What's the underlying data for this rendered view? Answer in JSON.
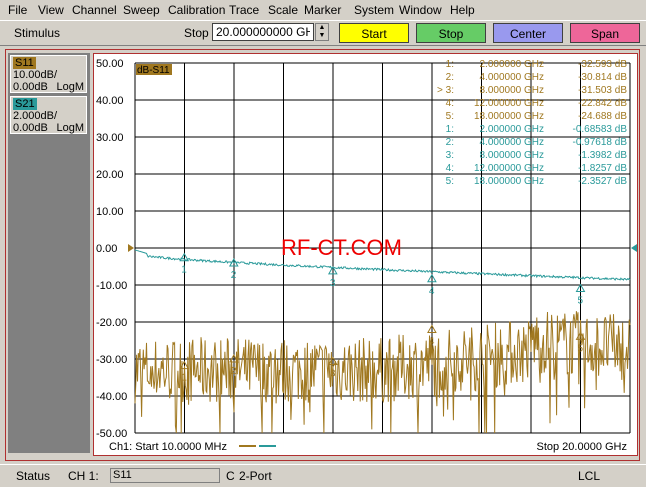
{
  "menu": [
    "File",
    "View",
    "Channel",
    "Sweep",
    "Calibration",
    "Trace",
    "Scale",
    "Marker",
    "System",
    "Window",
    "Help"
  ],
  "toolbar": {
    "stimulus_label": "Stimulus",
    "stop_label": "Stop",
    "stop_value": "20.000000000 GHz",
    "buttons": [
      {
        "label": "Start",
        "color": "#ffff00"
      },
      {
        "label": "Stop",
        "color": "#66cc66"
      },
      {
        "label": "Center",
        "color": "#9999ee"
      },
      {
        "label": "Span",
        "color": "#ee6699"
      }
    ]
  },
  "traces": [
    {
      "name": "S11",
      "scale": "10.00dB/",
      "ref": "0.00dB",
      "format": "LogM",
      "color": "#a07820"
    },
    {
      "name": "S21",
      "scale": "2.000dB/",
      "ref": "0.00dB",
      "format": "LogM",
      "color": "#2a9a9a"
    }
  ],
  "chart_data": {
    "type": "line",
    "trace_tag": "dB-S11",
    "watermark": "RF-CT.COM",
    "y_ticks": [
      "50.00",
      "40.00",
      "30.00",
      "20.00",
      "10.00",
      "0.00",
      "-10.00",
      "-20.00",
      "-30.00",
      "-40.00",
      "-50.00"
    ],
    "ylim": [
      -50,
      50
    ],
    "xlim_ghz": [
      0.01,
      20
    ],
    "start_text": "Ch1: Start  10.0000 MHz",
    "stop_text": "Stop  20.0000 GHz",
    "grid": true,
    "markers_s11": [
      {
        "id": "1:",
        "freq": "2.000000 GHz",
        "val": "-32.593 dB",
        "x": 2,
        "y": -32.593
      },
      {
        "id": "2:",
        "freq": "4.000000 GHz",
        "val": "-30.814 dB",
        "x": 4,
        "y": -30.814
      },
      {
        "id": "> 3:",
        "freq": "8.000000 GHz",
        "val": "-31.503 dB",
        "x": 8,
        "y": -31.503
      },
      {
        "id": "4:",
        "freq": "12.000000 GHz",
        "val": "-22.842 dB",
        "x": 12,
        "y": -22.842
      },
      {
        "id": "5:",
        "freq": "18.000000 GHz",
        "val": "-24.688 dB",
        "x": 18,
        "y": -24.688
      }
    ],
    "markers_s21": [
      {
        "id": "1:",
        "freq": "2.000000 GHz",
        "val": "-0.68583 dB",
        "x": 2,
        "y": -0.68583
      },
      {
        "id": "2:",
        "freq": "4.000000 GHz",
        "val": "-0.97618 dB",
        "x": 4,
        "y": -0.97618
      },
      {
        "id": "3:",
        "freq": "8.000000 GHz",
        "val": "-1.3982 dB",
        "x": 8,
        "y": -1.3982
      },
      {
        "id": "4:",
        "freq": "12.000000 GHz",
        "val": "-1.8257 dB",
        "x": 12,
        "y": -1.8257
      },
      {
        "id": "5:",
        "freq": "18.000000 GHz",
        "val": "-2.3527 dB",
        "x": 18,
        "y": -2.3527
      }
    ],
    "marker_numbers": [
      "1",
      "2",
      "3",
      "4",
      "5"
    ],
    "s21_scale_db_per_div": 2,
    "s11_scale_db_per_div": 10
  },
  "status": {
    "label": "Status",
    "channel": "CH 1:",
    "trace": "S11",
    "cal": "C",
    "port": "2-Port",
    "mode": "LCL"
  }
}
